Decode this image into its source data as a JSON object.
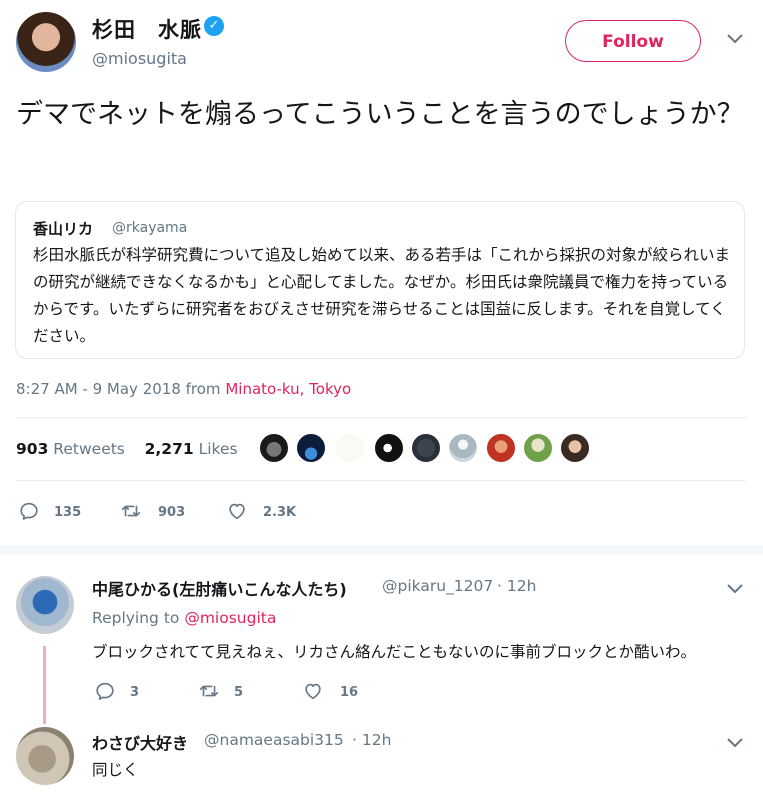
{
  "tweet": {
    "author_name": "杉田　水脈",
    "author_handle": "@miosugita",
    "follow_label": "Follow",
    "text": "デマでネットを煽るってこういうことを言うのでしょうか？",
    "quote": {
      "author_name": "香山リカ",
      "author_handle": "@rkayama",
      "text": "杉田水脈氏が科学研究費について追及し始めて以来、ある若手は「これから採択の対象が絞られいまの研究が継続できなくなるかも」と心配してました。なぜか。杉田氏は衆院議員で権力を持っているからです。いたずらに研究者をおびえさせ研究を滞らせることは国益に反します。それを自覚してください。"
    },
    "timestamp": "8:27 AM - 9 May 2018 from",
    "location": "Minato-ku, Tokyo",
    "retweets_count": "903",
    "retweets_label": "Retweets",
    "likes_count": "2,271",
    "likes_label": "Likes",
    "actions": {
      "replies": "135",
      "retweets": "903",
      "likes": "2.3K"
    }
  },
  "replies": [
    {
      "author_name": "中尾ひかる(左肘痛いこんな人たち)",
      "author_handle": "@pikaru_1207",
      "time": "· 12h",
      "replying_to_label": "Replying to",
      "replying_to_handle": "@miosugita",
      "text": "ブロックされてて見えねぇ、リカさん絡んだこともないのに事前ブロックとか酷いわ。",
      "actions": {
        "replies": "3",
        "retweets": "5",
        "likes": "16"
      }
    },
    {
      "author_name": "わさび大好き",
      "author_handle": "@namaeasabi315",
      "time": "· 12h",
      "text": "同じく"
    }
  ],
  "colors": {
    "accent": "#e0245e",
    "link": "#1da1f2",
    "muted": "#657786",
    "thread_line": "#f5a8c1"
  },
  "icons": {
    "more": "chevron-down-icon",
    "verified": "verified-badge-icon",
    "reply": "reply-icon",
    "retweet": "retweet-icon",
    "like": "heart-icon"
  }
}
